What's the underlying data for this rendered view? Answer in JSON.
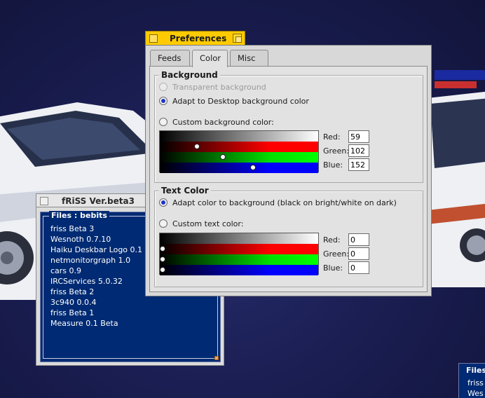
{
  "friss_window": {
    "title": "fRiSS Ver.beta3",
    "box_label": "Files : bebits",
    "items": [
      "friss Beta 3",
      "Wesnoth 0.7.10",
      "Haiku Deskbar Logo 0.1",
      "netmonitorgraph 1.0",
      "cars 0.9",
      "IRCServices 5.0.32",
      "friss Beta 2",
      "3c940 0.0.4",
      "friss Beta 1",
      "Measure 0.1 Beta"
    ]
  },
  "preferences": {
    "title": "Preferences",
    "tabs": [
      "Feeds",
      "Color",
      "Misc"
    ],
    "active_tab": "Color",
    "background": {
      "label": "Background",
      "options": {
        "transparent": "Transparent background",
        "adapt_desktop": "Adapt to Desktop background color",
        "custom": "Custom background color:"
      },
      "selected": "adapt_desktop",
      "red_label": "Red:",
      "green_label": "Green:",
      "blue_label": "Blue:",
      "red": "59",
      "green": "102",
      "blue": "152"
    },
    "text_color": {
      "label": "Text Color",
      "options": {
        "adapt": "Adapt color to background (black on bright/white on dark)",
        "custom": "Custom text color:"
      },
      "selected": "adapt",
      "red_label": "Red:",
      "green_label": "Green:",
      "blue_label": "Blue:",
      "red": "0",
      "green": "0",
      "blue": "0"
    }
  },
  "mini_window": {
    "box_label": "Files",
    "items": [
      "friss",
      "Wes"
    ]
  },
  "colors": {
    "desktop": "#1a1e52",
    "tab_yellow": "#ffcb00",
    "list_blue": "#002a73",
    "radio_selected": "#1e34c8"
  }
}
